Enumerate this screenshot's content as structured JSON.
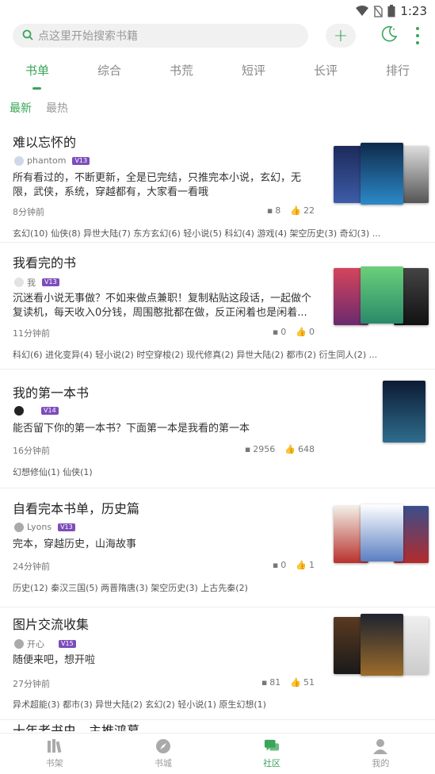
{
  "status": {
    "time": "1:23"
  },
  "search": {
    "placeholder": "点这里开始搜索书籍"
  },
  "tabs": [
    "书单",
    "综合",
    "书荒",
    "短评",
    "长评",
    "排行"
  ],
  "subtabs": [
    "最新",
    "最热"
  ],
  "items": [
    {
      "title": "难以忘怀的",
      "user": "phantom",
      "level": "13",
      "desc": "所有看过的，不断更新，全是已完结，只推完本小说，玄幻，无限，武侠，系统，穿越都有，大家看一看哦",
      "time": "8分钟前",
      "comments": "8",
      "likes": "22",
      "tags": "玄幻(10) 仙侠(8) 异世大陆(7) 东方玄幻(6) 轻小说(5) 科幻(4) 游戏(4) 架空历史(3) 奇幻(3) ..."
    },
    {
      "title": "我看完的书",
      "user": "我",
      "level": "13",
      "desc": "沉迷看小说无事做？不如来做点兼职！复制粘贴这段话，一起做个复读机，每天收入0分钱，周围憨批都在做，反正闲着也是闲着...",
      "time": "11分钟前",
      "comments": "0",
      "likes": "0",
      "tags": "科幻(6) 进化变异(4) 轻小说(2) 时空穿梭(2) 现代修真(2) 异世大陆(2) 都市(2) 衍生同人(2) ..."
    },
    {
      "title": "我的第一本书",
      "user": "",
      "level": "14",
      "desc": "能否留下你的第一本书？下面第一本是我看的第一本",
      "time": "16分钟前",
      "comments": "2956",
      "likes": "648",
      "tags": "幻想修仙(1) 仙侠(1)"
    },
    {
      "title": "自看完本书单，历史篇",
      "user": "Lyons",
      "level": "13",
      "desc": "完本，穿越历史，山海故事",
      "time": "24分钟前",
      "comments": "0",
      "likes": "1",
      "tags": "历史(12) 秦汉三国(5) 两晋隋唐(3) 架空历史(3) 上古先秦(2)"
    },
    {
      "title": "图片交流收集",
      "user": "开心",
      "level": "15",
      "desc": "随便来吧，想开啦",
      "time": "27分钟前",
      "comments": "81",
      "likes": "51",
      "tags": "异术超能(3) 都市(3) 异世大陆(2) 玄幻(2) 轻小说(1) 原生幻想(1)"
    }
  ],
  "partial_title": "十年老书虫，主推鸿幕",
  "bottom_nav": [
    "书架",
    "书城",
    "社区",
    "我的"
  ],
  "colors": {
    "accent": "#3aa55a",
    "level_badge": "#7c4dbb"
  }
}
